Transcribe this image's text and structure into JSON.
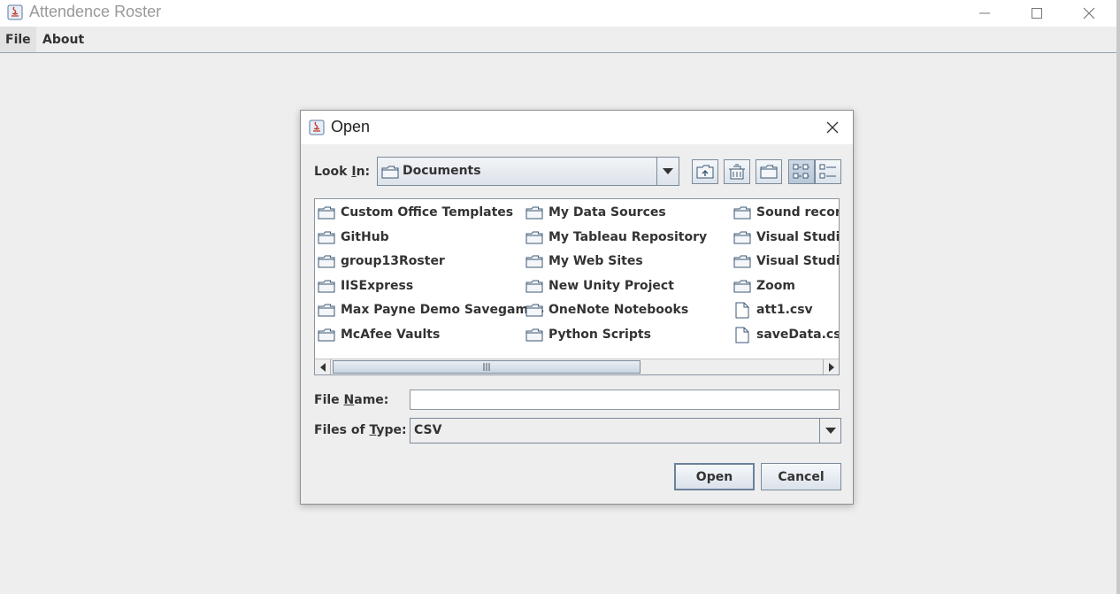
{
  "window": {
    "title": "Attendence Roster",
    "controls": {
      "minimize": "—",
      "maximize": "☐",
      "close": "✕"
    }
  },
  "menubar": {
    "items": [
      {
        "label": "File"
      },
      {
        "label": "About"
      }
    ]
  },
  "dialog": {
    "title": "Open",
    "close_icon": "close-icon",
    "look_in": {
      "label_pre": "Look ",
      "label_mnemonic": "I",
      "label_post": "n:",
      "value": "Documents"
    },
    "toolbar": [
      "up-one-level-icon",
      "home-icon",
      "new-folder-icon",
      "list-view-icon",
      "details-view-icon"
    ],
    "files": [
      {
        "name": "Custom Office Templates",
        "type": "folder"
      },
      {
        "name": "GitHub",
        "type": "folder"
      },
      {
        "name": "group13Roster",
        "type": "folder"
      },
      {
        "name": "IISExpress",
        "type": "folder"
      },
      {
        "name": "Max Payne Demo Savegames",
        "type": "folder"
      },
      {
        "name": "McAfee Vaults",
        "type": "folder"
      },
      {
        "name": "My Data Sources",
        "type": "folder"
      },
      {
        "name": "My Tableau Repository",
        "type": "folder"
      },
      {
        "name": "My Web Sites",
        "type": "folder"
      },
      {
        "name": "New Unity Project",
        "type": "folder"
      },
      {
        "name": "OneNote Notebooks",
        "type": "folder"
      },
      {
        "name": "Python Scripts",
        "type": "folder"
      },
      {
        "name": "Sound recordings",
        "type": "folder"
      },
      {
        "name": "Visual Studio",
        "type": "folder"
      },
      {
        "name": "Visual Studio",
        "type": "folder"
      },
      {
        "name": "Zoom",
        "type": "folder"
      },
      {
        "name": "att1.csv",
        "type": "file"
      },
      {
        "name": "saveData.csv",
        "type": "file"
      }
    ],
    "file_name": {
      "label_pre": "File ",
      "label_mnemonic": "N",
      "label_post": "ame:",
      "value": ""
    },
    "file_type": {
      "label_pre": "Files of ",
      "label_mnemonic": "T",
      "label_post": "ype:",
      "value": "CSV"
    },
    "buttons": {
      "open": "Open",
      "cancel": "Cancel"
    }
  }
}
